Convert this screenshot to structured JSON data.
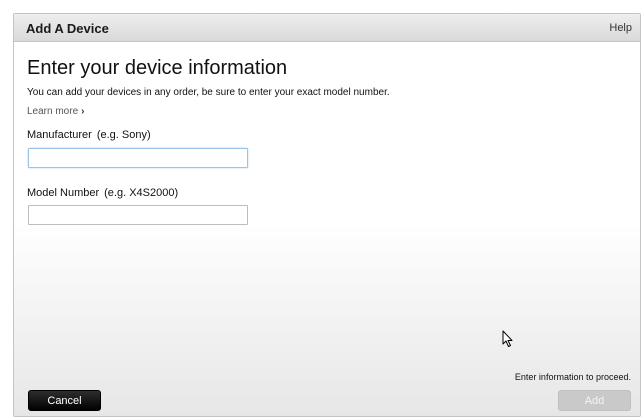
{
  "dialog": {
    "title": "Add A Device",
    "help_label": "Help"
  },
  "main": {
    "heading": "Enter your device information",
    "description": "You can add your devices in any order, be sure to enter your exact model number.",
    "learn_more": "Learn more",
    "learn_more_chevron": "›"
  },
  "fields": {
    "manufacturer": {
      "label": "Manufacturer",
      "hint": "(e.g. Sony)",
      "value": "",
      "focused": true
    },
    "model_number": {
      "label": "Model Number",
      "hint": "(e.g. X4S2000)",
      "value": ""
    }
  },
  "footer": {
    "status": "Enter information to proceed.",
    "cancel_label": "Cancel",
    "add_label": "Add",
    "add_enabled": false
  }
}
